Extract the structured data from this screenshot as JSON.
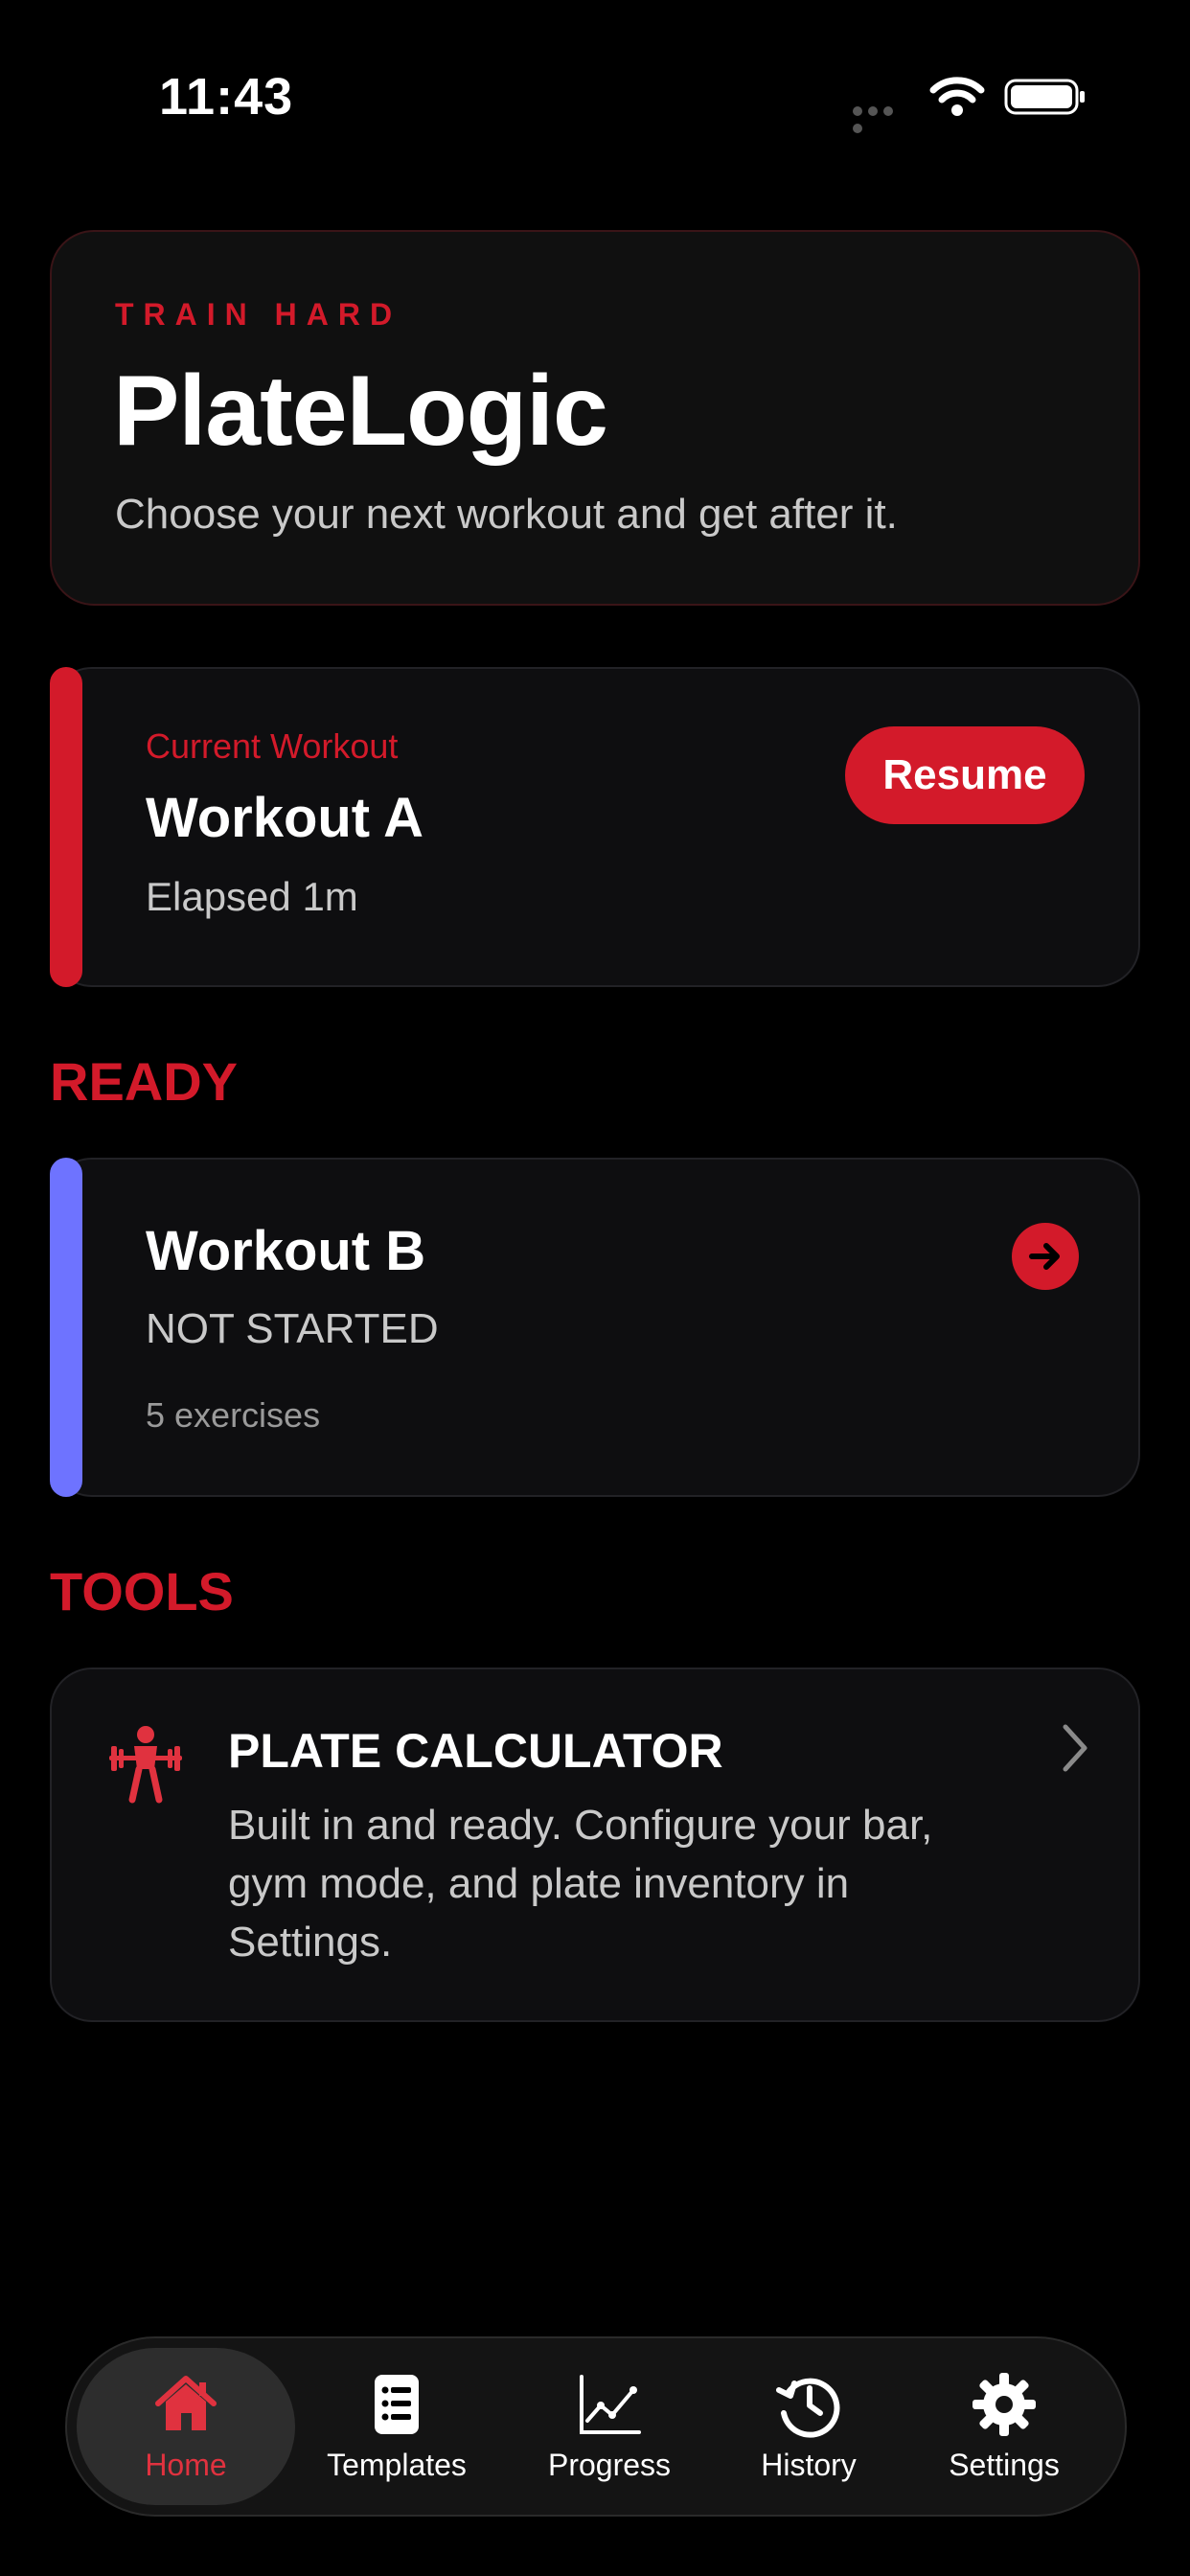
{
  "status_bar": {
    "time": "11:43"
  },
  "hero": {
    "eyebrow": "TRAIN HARD",
    "title": "PlateLogic",
    "subtitle": "Choose your next workout and get after it."
  },
  "current_workout": {
    "label": "Current Workout",
    "name": "Workout A",
    "elapsed": "Elapsed 1m",
    "resume_label": "Resume"
  },
  "sections": {
    "ready": "READY",
    "tools": "TOOLS"
  },
  "ready_workout": {
    "name": "Workout B",
    "status": "NOT STARTED",
    "exercise_count": "5 exercises",
    "icon": "arrow-right-circle-icon"
  },
  "plate_calculator": {
    "title": "PLATE CALCULATOR",
    "description": "Built in and ready. Configure your bar, gym mode, and plate inventory in Settings.",
    "icon": "weightlifter-icon"
  },
  "tab_bar": {
    "active": "Home",
    "tabs": [
      {
        "label": "Home",
        "icon": "house-icon"
      },
      {
        "label": "Templates",
        "icon": "list-document-icon"
      },
      {
        "label": "Progress",
        "icon": "line-chart-icon"
      },
      {
        "label": "History",
        "icon": "clock-history-icon"
      },
      {
        "label": "Settings",
        "icon": "gear-icon"
      }
    ]
  },
  "colors": {
    "accent": "#d31a2a",
    "ready_accent": "#6e73ff",
    "background": "#000000",
    "card": "#0e0e10"
  }
}
